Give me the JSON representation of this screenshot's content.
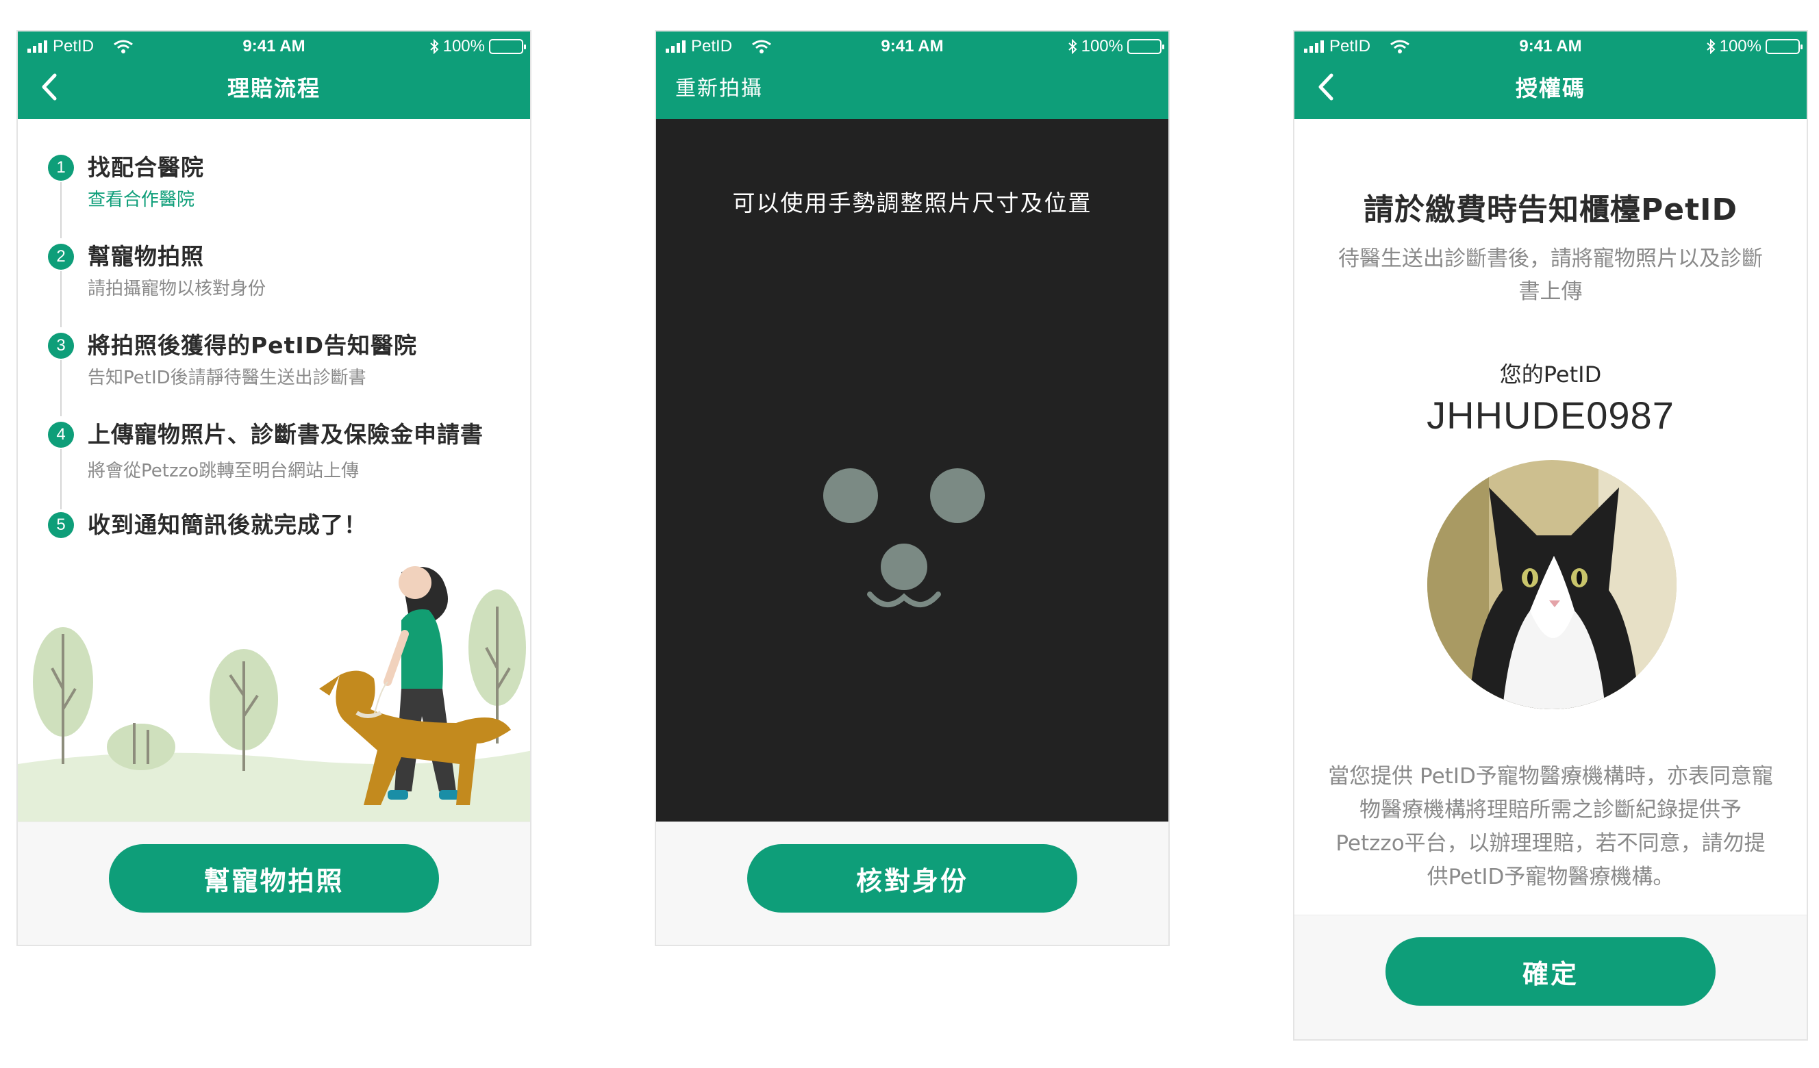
{
  "colors": {
    "brand": "#0e9e79",
    "dark_bg": "#222222",
    "footer_bg": "#f7f7f7",
    "muted_text": "#8a8a8a"
  },
  "status_bar": {
    "carrier": "PetID",
    "time": "9:41 AM",
    "battery": "100%"
  },
  "screen1": {
    "title": "理賠流程",
    "steps": [
      {
        "num": "1",
        "title": "找配合醫院",
        "sub": "查看合作醫院"
      },
      {
        "num": "2",
        "title": "幫寵物拍照",
        "sub": "請拍攝寵物以核對身份"
      },
      {
        "num": "3",
        "title": "將拍照後獲得的PetID告知醫院",
        "sub": "告知PetID後請靜待醫生送出診斷書"
      },
      {
        "num": "4",
        "title": "上傳寵物照片、診斷書及保險金申請書",
        "sub": "將會從Petzzo跳轉至明台網站上傳"
      },
      {
        "num": "5",
        "title": "收到通知簡訊後就完成了！"
      }
    ],
    "button": "幫寵物拍照"
  },
  "screen2": {
    "title": "重新拍攝",
    "hint": "可以使用手勢調整照片尺寸及位置",
    "button": "核對身份"
  },
  "screen3": {
    "title": "授權碼",
    "heading": "請於繳費時告知櫃檯PetID",
    "sub": "待醫生送出診斷書後，請將寵物照片以及診斷書上傳",
    "petid_label": "您的PetID",
    "petid_value": "JHHUDE0987",
    "consent": "當您提供 PetID予寵物醫療機構時，亦表同意寵物醫療機構將理賠所需之診斷紀錄提供予Petzzo平台，以辦理理賠，若不同意，請勿提供PetID予寵物醫療機構。",
    "button": "確定"
  }
}
